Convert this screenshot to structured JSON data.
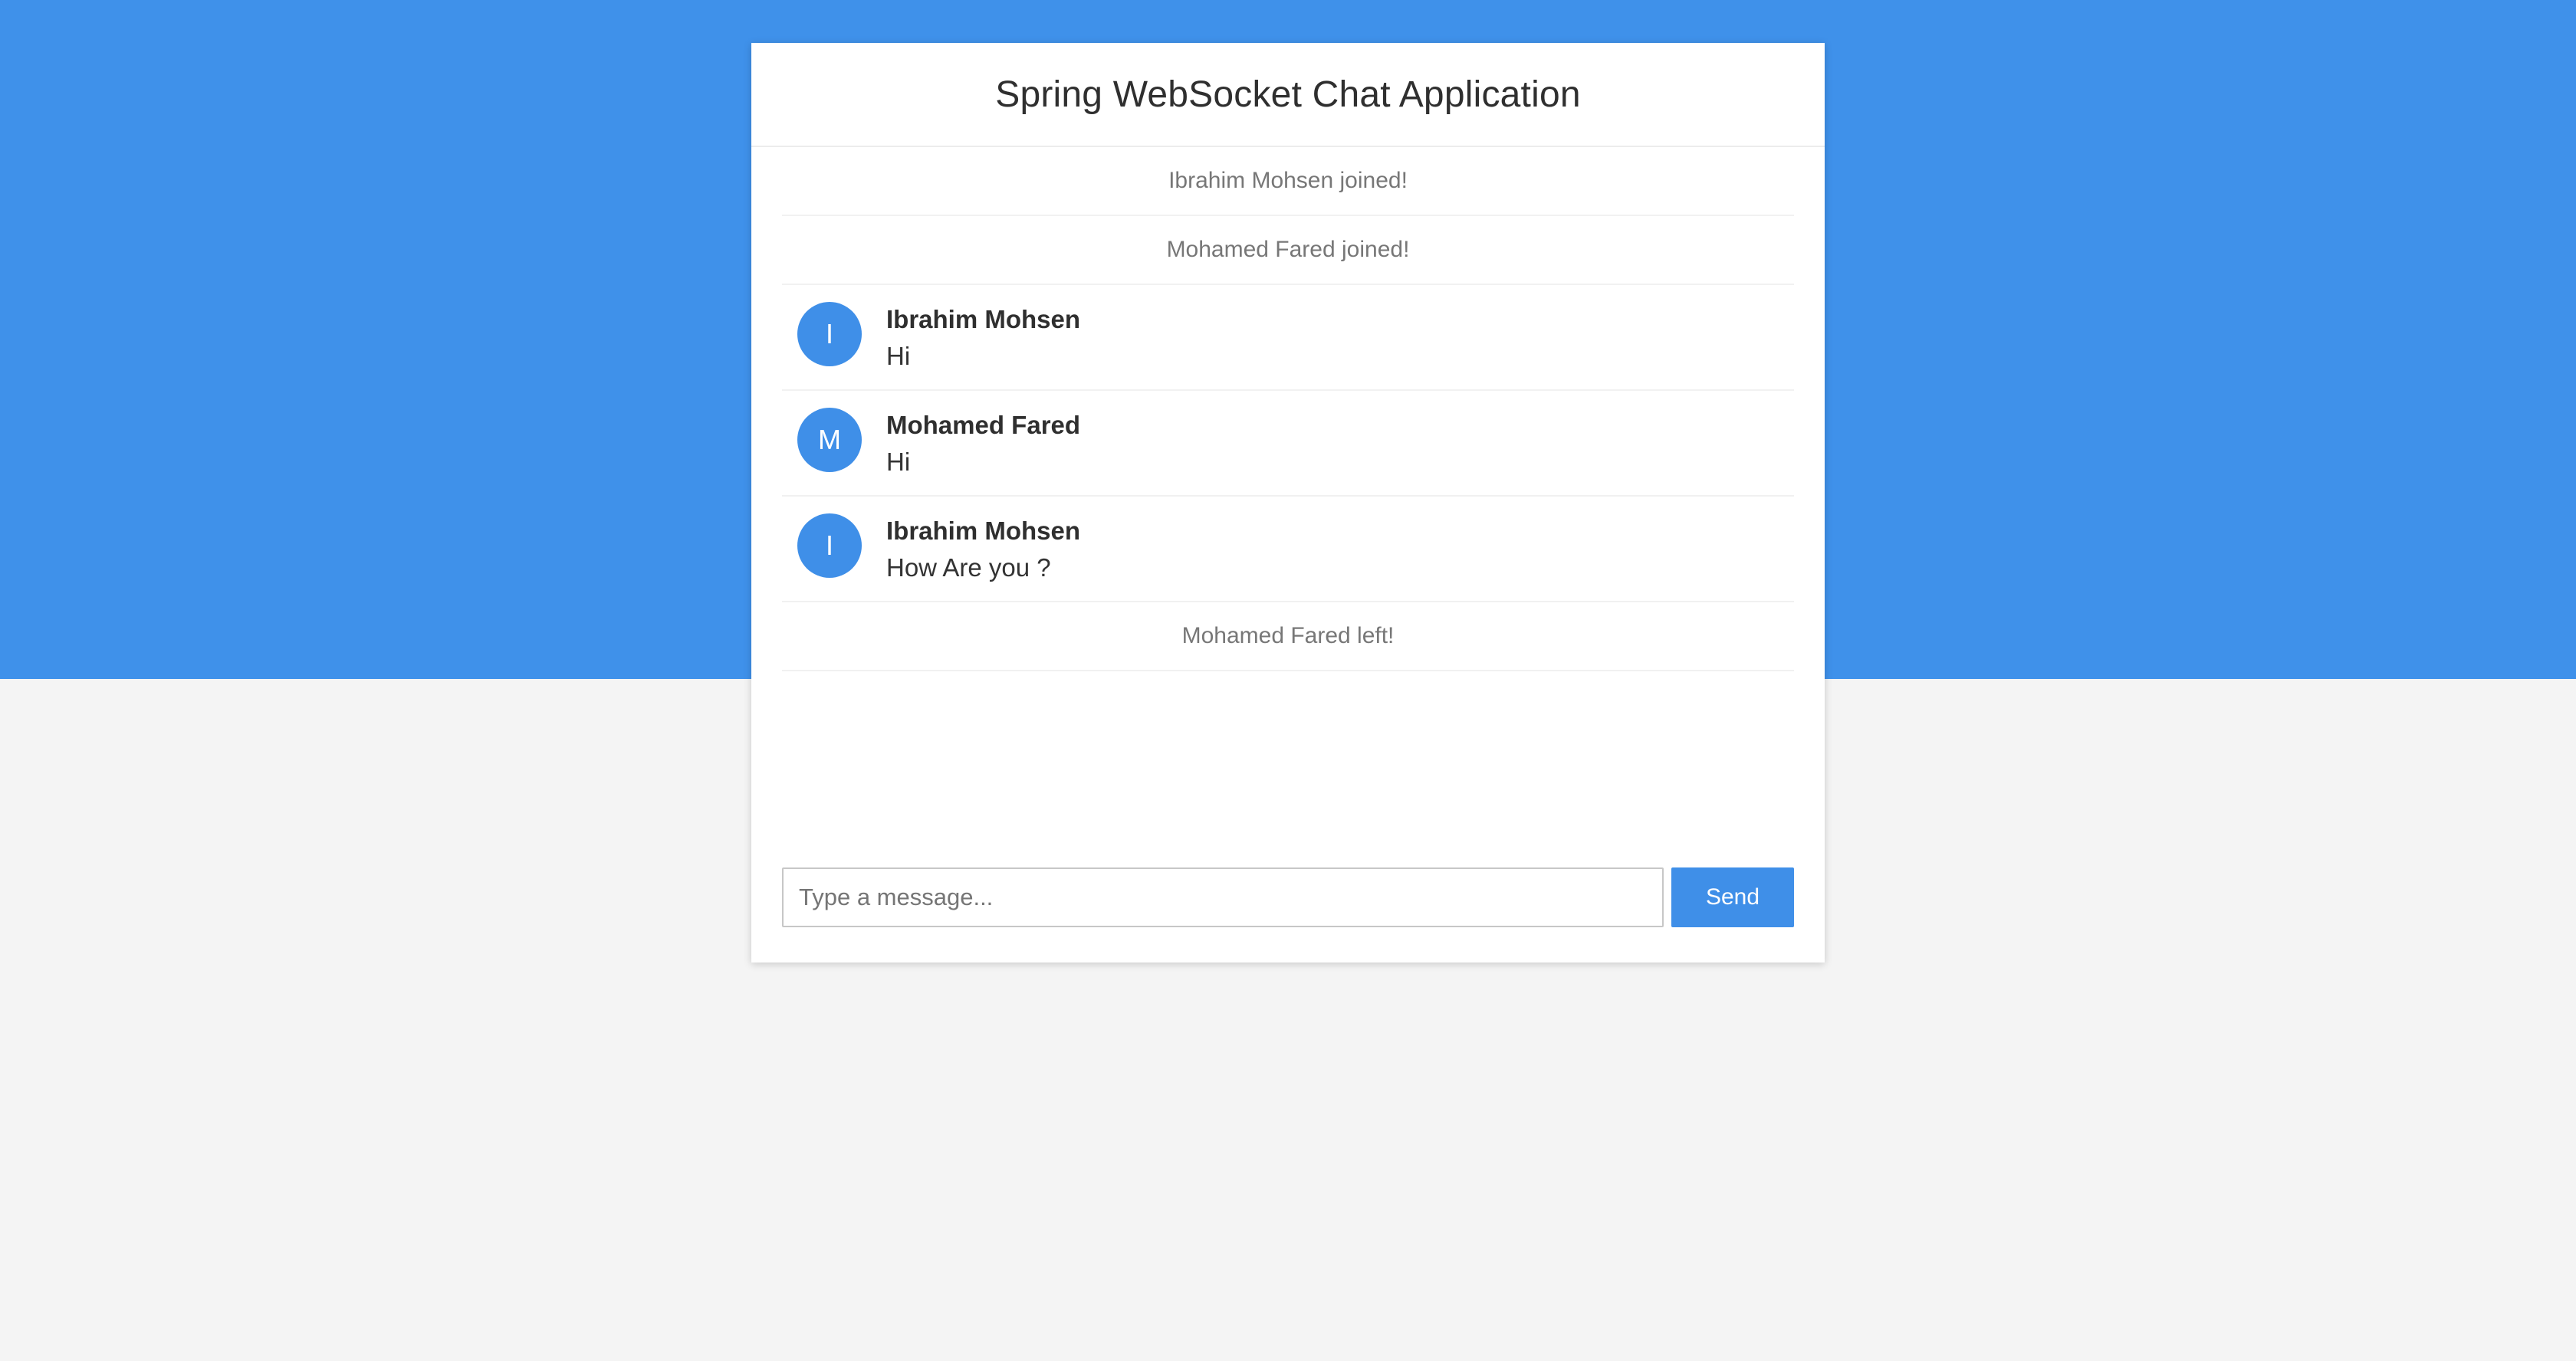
{
  "app": {
    "title": "Spring WebSocket Chat Application"
  },
  "messages": [
    {
      "type": "event",
      "text": "Ibrahim Mohsen joined!"
    },
    {
      "type": "event",
      "text": "Mohamed Fared joined!"
    },
    {
      "type": "chat",
      "avatar": "I",
      "sender": "Ibrahim Mohsen",
      "text": "Hi"
    },
    {
      "type": "chat",
      "avatar": "M",
      "sender": "Mohamed Fared",
      "text": "Hi"
    },
    {
      "type": "chat",
      "avatar": "I",
      "sender": "Ibrahim Mohsen",
      "text": "How Are you ?"
    },
    {
      "type": "event",
      "text": "Mohamed Fared left!"
    }
  ],
  "composer": {
    "placeholder": "Type a message...",
    "value": "",
    "send_label": "Send"
  },
  "colors": {
    "primary": "#3f91ea",
    "background": "#f4f4f4",
    "card": "#ffffff"
  }
}
